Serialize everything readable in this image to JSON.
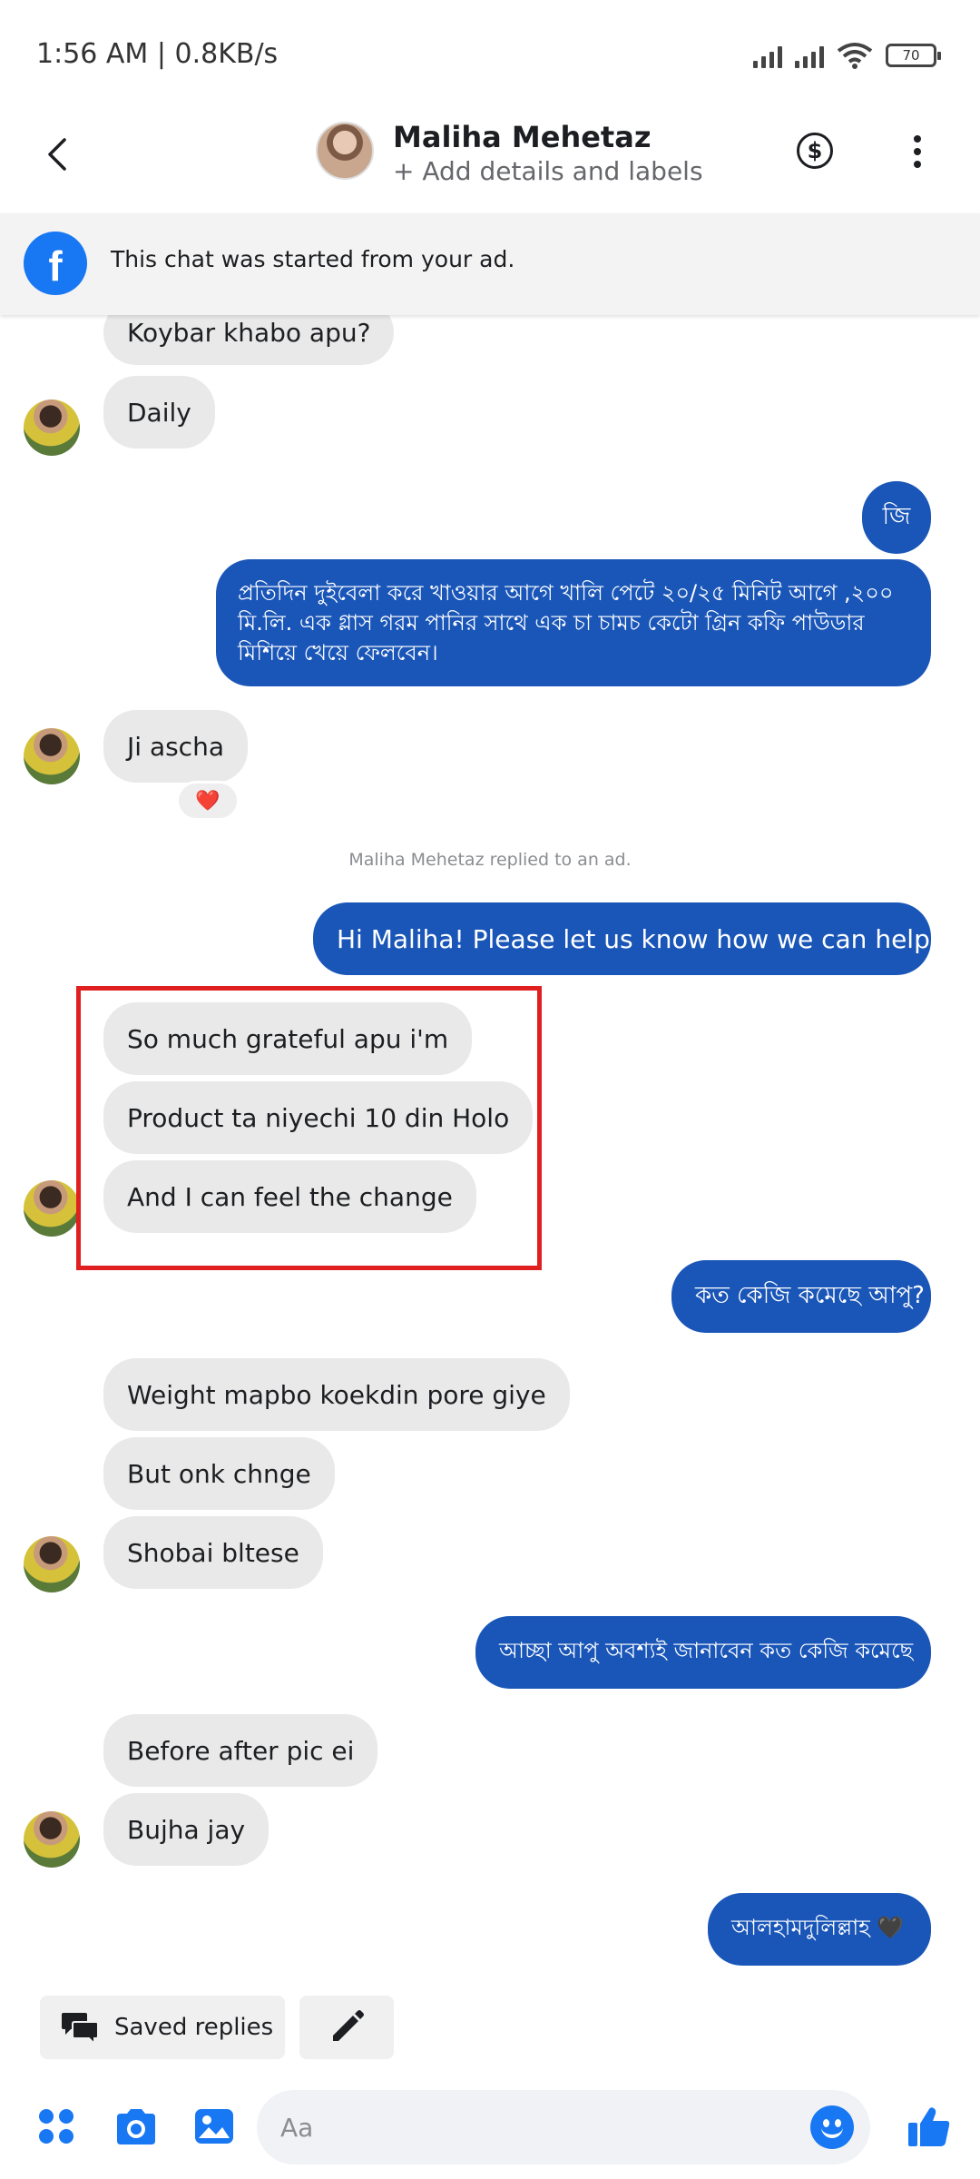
{
  "status_bar": {
    "time_text": "1:56 AM | 0.8KB/s",
    "battery": "70"
  },
  "header": {
    "contact_name": "Maliha Mehetaz",
    "subtitle": "+ Add details and labels"
  },
  "ad_banner": {
    "text": "This chat was started from your ad."
  },
  "messages": {
    "m1": "Koybar khabo apu?",
    "m2": "Daily",
    "m3": "জি",
    "m4": "প্রতিদিন দুইবেলা করে খাওয়ার আগে খালি পেটে ২০/২৫ মিনিট আগে ,২০০ মি.লি. এক গ্লাস গরম পানির সাথে এক চা চামচ কেটো গ্রিন কফি পাউডার মিশিয়ে খেয়ে ফেলবেন।",
    "m5": "Ji ascha",
    "m6": "Hi Maliha! Please let us know how we can help you.",
    "m7": "So much grateful apu i'm",
    "m8": "Product ta niyechi 10 din Holo",
    "m9": "And I can feel the change",
    "m10": "কত কেজি কমেছে আপু?",
    "m11": "Weight mapbo koekdin pore giye",
    "m12": "But onk chnge",
    "m13": "Shobai bltese",
    "m14": "আচ্ছা আপু অবশ্যই জানাবেন কত কেজি কমেছে",
    "m15": "Before after pic ei",
    "m16": "Bujha jay",
    "m17": "আলহামদুলিল্লাহ 🖤"
  },
  "system_note": "Maliha Mehetaz replied to an ad.",
  "reaction": "❤️",
  "quick_replies": {
    "saved_label": "Saved replies"
  },
  "composer": {
    "placeholder": "Aa"
  },
  "colors": {
    "outgoing_bubble": "#1a56b8",
    "incoming_bubble": "#e9e9e9",
    "accent": "#1877f2",
    "highlight_box": "#e02020"
  }
}
